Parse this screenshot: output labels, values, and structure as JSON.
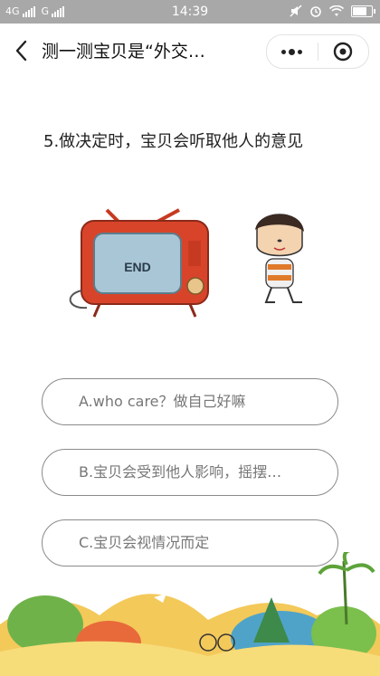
{
  "status": {
    "network": "4G",
    "carrier": "G",
    "time": "14:39"
  },
  "nav": {
    "title": "测一测宝贝是“外交…"
  },
  "question": {
    "text": "5.做决定时，宝贝会听取他人的意见",
    "tv_screen_text": "END"
  },
  "options": [
    {
      "label": "A.who care？做自己好嘛"
    },
    {
      "label": "B.宝贝会受到他人影响，摇摆…"
    },
    {
      "label": "C.宝贝会视情况而定"
    }
  ],
  "colors": {
    "tv_red": "#d8442a",
    "tv_screen": "#a9c6d6",
    "statusbar": "#a8a8a8",
    "option_border": "#8a8a8a"
  }
}
